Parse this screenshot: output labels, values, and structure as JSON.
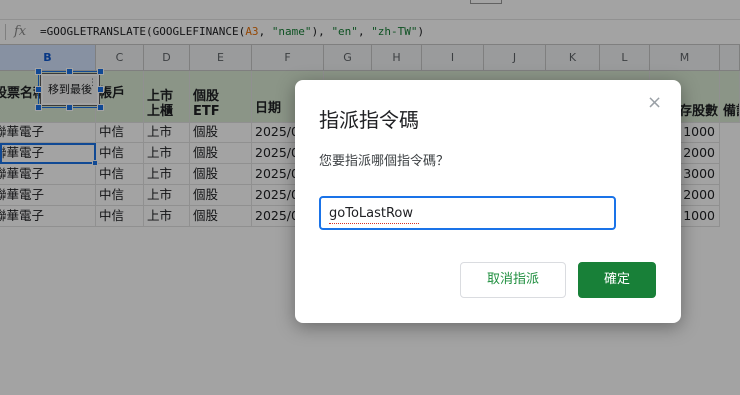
{
  "formula_bar": {
    "fx_label": "fx",
    "formula_prefix": "=GOOGLETRANSLATE(GOOGLEFINANCE(",
    "formula_ref": "A3",
    "formula_sep1": ", ",
    "formula_str1": "\"name\"",
    "formula_sep2": "), ",
    "formula_str2": "\"en\"",
    "formula_sep3": ", ",
    "formula_str3": "\"zh-TW\"",
    "formula_suffix": ")"
  },
  "columns": [
    "B",
    "C",
    "D",
    "E",
    "F",
    "G",
    "H",
    "I",
    "J",
    "K",
    "L",
    "M"
  ],
  "header_row": {
    "b": "股票名稱",
    "c": "帳戶",
    "d": "上市\n上櫃",
    "e": "個股\nETF",
    "f": "日期",
    "m": "存股數",
    "n": "備註"
  },
  "rows": [
    {
      "name": "聯華電子",
      "account": "中信",
      "market": "上市",
      "type": "個股",
      "date": "2025/0",
      "shares": "1000"
    },
    {
      "name": "聯華電子",
      "account": "中信",
      "market": "上市",
      "type": "個股",
      "date": "2025/0",
      "shares": "2000"
    },
    {
      "name": "聯華電子",
      "account": "中信",
      "market": "上市",
      "type": "個股",
      "date": "2025/0",
      "shares": "3000"
    },
    {
      "name": "聯華電子",
      "account": "中信",
      "market": "上市",
      "type": "個股",
      "date": "2025/0",
      "shares": "2000"
    },
    {
      "name": "聯華電子",
      "account": "中信",
      "market": "上市",
      "type": "個股",
      "date": "2025/0",
      "shares": "1000"
    }
  ],
  "drawing_button": {
    "label": "移到最後",
    "menu": "⋮"
  },
  "dialog": {
    "title": "指派指令碼",
    "close_symbol": "×",
    "prompt": "您要指派哪個指令碼？",
    "input_value": "goToLastRow",
    "cancel_label": "取消指派",
    "ok_label": "確定"
  },
  "colors": {
    "header_row_bg": "#d9ead3",
    "accent_blue": "#1a73e8",
    "ok_button": "#188038",
    "cancel_text": "#1e8e3e"
  }
}
